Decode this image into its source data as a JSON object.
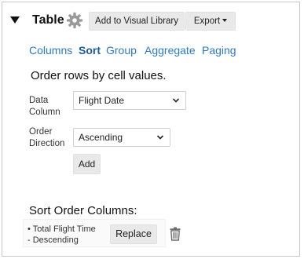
{
  "header": {
    "title": "Table",
    "add_to_library_label": "Add to Visual Library",
    "export_label": "Export"
  },
  "tabs": [
    {
      "label": "Columns",
      "active": false
    },
    {
      "label": "Sort",
      "active": true
    },
    {
      "label": "Group",
      "active": false
    },
    {
      "label": "Aggregate",
      "active": false
    },
    {
      "label": "Paging",
      "active": false
    }
  ],
  "sort_panel": {
    "heading": "Order rows by cell values.",
    "data_column_label_line1": "Data",
    "data_column_label_line2": "Column",
    "data_column_value": "Flight Date",
    "order_direction_label_line1": "Order",
    "order_direction_label_line2": "Direction",
    "order_direction_value": "Ascending",
    "add_label": "Add"
  },
  "sort_order": {
    "heading": "Sort Order Columns:",
    "items": [
      {
        "line1": "• Total Flight Time",
        "line2": "- Descending",
        "replace_label": "Replace"
      }
    ]
  },
  "colors": {
    "tab_link": "#2a7bc8",
    "tab_active": "#1b5aa0",
    "button_bg": "#e9e9e9",
    "gear": "#9a9a9a"
  },
  "icons": [
    "caret-down-icon",
    "gear-icon",
    "chevron-down-icon",
    "trash-icon"
  ]
}
